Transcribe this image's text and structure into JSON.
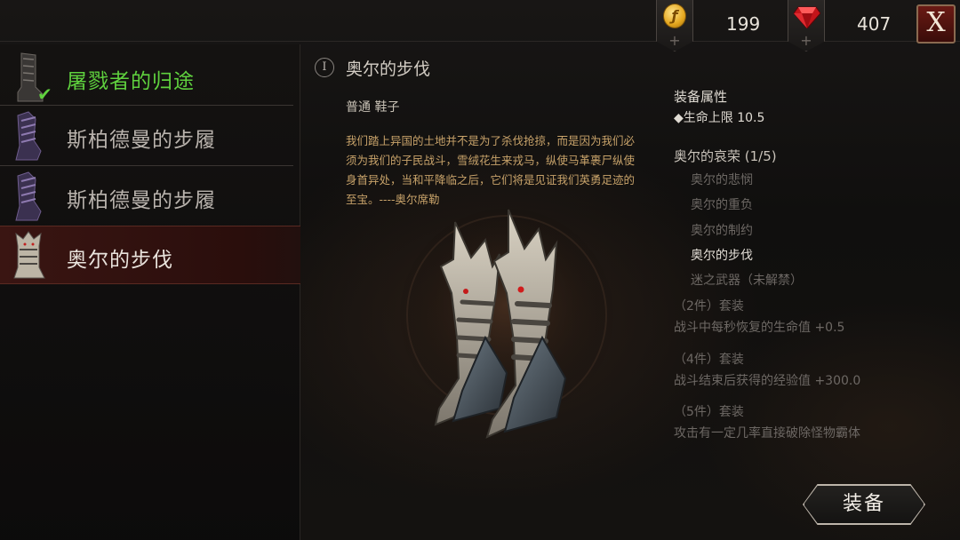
{
  "currency": {
    "gold": {
      "value": "199",
      "icon": "gold-coin-icon",
      "add": "+"
    },
    "gems": {
      "value": "407",
      "icon": "red-gem-icon",
      "add": "+"
    }
  },
  "close": {
    "label": "X"
  },
  "item_list": [
    {
      "name": "屠戮者的归途",
      "state": "equipped",
      "icon": "dark-boots-icon"
    },
    {
      "name": "斯柏德曼的步履",
      "state": "normal",
      "icon": "purple-boots-icon"
    },
    {
      "name": "斯柏德曼的步履",
      "state": "normal",
      "icon": "purple-boots-icon"
    },
    {
      "name": "奥尔的步伐",
      "state": "selected",
      "icon": "bone-boots-icon"
    }
  ],
  "detail": {
    "info_glyph": "I",
    "title": "奥尔的步伐",
    "subtitle": "普通 鞋子",
    "description": "我们踏上异国的土地并不是为了杀伐抢掠，而是因为我们必须为我们的子民战斗，雪绒花生来戎马，纵使马革裹尸纵使身首异处，当和平降临之后，它们将是见证我们英勇足迹的至宝。----奥尔席勒"
  },
  "attributes": {
    "header": "装备属性",
    "lines": [
      "◆生命上限 10.5"
    ]
  },
  "set": {
    "title": "奥尔的哀荣 (1/5)",
    "pieces": [
      {
        "name": "奥尔的悲悯",
        "owned": false
      },
      {
        "name": "奥尔的重负",
        "owned": false
      },
      {
        "name": "奥尔的制约",
        "owned": false
      },
      {
        "name": "奥尔的步伐",
        "owned": true
      },
      {
        "name": "迷之武器（未解禁）",
        "owned": false
      }
    ],
    "bonuses": [
      {
        "label": "（2件）套装",
        "text": "战斗中每秒恢复的生命值 +0.5"
      },
      {
        "label": "（4件）套装",
        "text": "战斗结束后获得的经验值 +300.0"
      },
      {
        "label": "（5件）套装",
        "text": "攻击有一定几率直接破除怪物霸体"
      }
    ]
  },
  "equip_button": {
    "label": "装备"
  }
}
